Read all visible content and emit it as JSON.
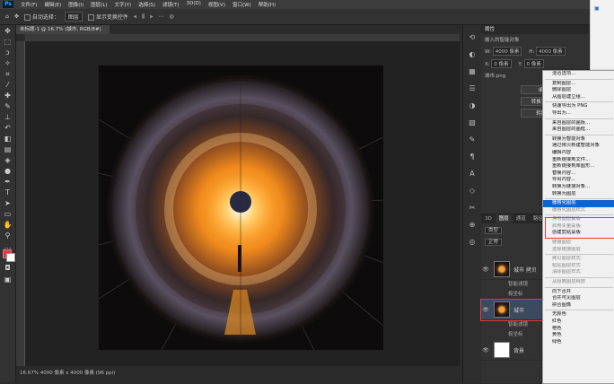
{
  "menubar": {
    "items": [
      "文件(F)",
      "编辑(E)",
      "图像(I)",
      "图层(L)",
      "文字(Y)",
      "选择(S)",
      "滤镜(T)",
      "3D(D)",
      "视图(V)",
      "窗口(W)",
      "帮助(H)"
    ]
  },
  "options": {
    "auto_select": "自动选择：",
    "layer_select": "图层",
    "show_transform": "显示变换控件"
  },
  "document": {
    "tab": "未标题-1 @ 16.7% (城市, RGB/8#)",
    "status": "16.67%    4000 像素 x 4000 像素 (96 ppi)"
  },
  "properties": {
    "header": "属性",
    "title": "嵌入的智能对象",
    "w_label": "W:",
    "w_value": "4000 像素",
    "h_label": "H:",
    "h_value": "4000 像素",
    "x_label": "X:",
    "x_value": "0 像素",
    "y_label": "Y:",
    "y_value": "0 像素",
    "filename": "城市.png",
    "btn1": "编辑内容",
    "btn2": "转换为链接对象",
    "btn3": "转换为图层"
  },
  "layers": {
    "tabs": [
      "3D",
      "图层",
      "通道",
      "路径"
    ],
    "kind": "类型",
    "blend": "正常",
    "rows": [
      {
        "name": "城市 拷贝",
        "sub1": "智能滤镜",
        "sub2": "极坐标"
      },
      {
        "name": "城市",
        "sub1": "智能滤镜",
        "sub2": "极坐标"
      },
      {
        "name": "背景"
      }
    ]
  },
  "context_menu": {
    "items": [
      {
        "label": "混合选项...",
        "state": "normal"
      },
      {
        "sep": true
      },
      {
        "label": "复制图层...",
        "state": "normal"
      },
      {
        "label": "删除图层",
        "state": "normal"
      },
      {
        "label": "从图层建立组...",
        "state": "normal"
      },
      {
        "sep": true
      },
      {
        "label": "快速导出为 PNG",
        "state": "normal"
      },
      {
        "label": "导出为...",
        "state": "normal"
      },
      {
        "sep": true
      },
      {
        "label": "来自图层的画板...",
        "state": "normal"
      },
      {
        "label": "来自图层的画框...",
        "state": "normal"
      },
      {
        "sep": true
      },
      {
        "label": "转换为智能对象",
        "state": "normal"
      },
      {
        "label": "通过拷贝新建智能对象",
        "state": "normal"
      },
      {
        "label": "编辑内容",
        "state": "normal"
      },
      {
        "label": "重新链接到文件...",
        "state": "normal"
      },
      {
        "label": "重新链接到库图形...",
        "state": "normal"
      },
      {
        "label": "替换内容...",
        "state": "normal"
      },
      {
        "label": "导出内容...",
        "state": "normal"
      },
      {
        "label": "转换为链接对象...",
        "state": "normal"
      },
      {
        "label": "转换为图层",
        "state": "normal"
      },
      {
        "sep": true
      },
      {
        "label": "栅格化图层",
        "state": "highlight"
      },
      {
        "label": "栅格化图层样式",
        "state": "disabled"
      },
      {
        "sep": true
      },
      {
        "label": "停用图层蒙版",
        "state": "disabled"
      },
      {
        "label": "启用矢量蒙版",
        "state": "disabled"
      },
      {
        "label": "创建剪贴蒙版",
        "state": "normal"
      },
      {
        "sep": true
      },
      {
        "label": "链接图层",
        "state": "disabled"
      },
      {
        "label": "选择链接图层",
        "state": "disabled"
      },
      {
        "sep": true
      },
      {
        "label": "拷贝图层样式",
        "state": "disabled"
      },
      {
        "label": "粘贴图层样式",
        "state": "disabled"
      },
      {
        "label": "清除图层样式",
        "state": "disabled"
      },
      {
        "sep": true
      },
      {
        "label": "从隔离图层释放",
        "state": "disabled"
      },
      {
        "sep": true
      },
      {
        "label": "向下合并",
        "state": "normal"
      },
      {
        "label": "合并可见图层",
        "state": "normal"
      },
      {
        "label": "拼合图像",
        "state": "normal"
      },
      {
        "sep": true
      },
      {
        "label": "无颜色",
        "state": "normal"
      },
      {
        "label": "红色",
        "state": "normal"
      },
      {
        "label": "橙色",
        "state": "normal"
      },
      {
        "label": "黄色",
        "state": "normal"
      },
      {
        "label": "绿色",
        "state": "normal"
      }
    ]
  },
  "colors": {
    "accent": "#0a64d6",
    "highlight_box": "#e53935"
  }
}
